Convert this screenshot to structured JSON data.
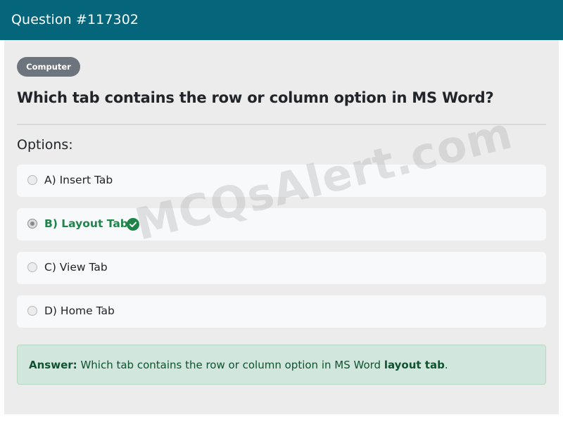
{
  "header": {
    "title": "Question #117302"
  },
  "badge": {
    "label": "Computer"
  },
  "question": {
    "text": "Which tab contains the row or column option in MS Word?"
  },
  "options_heading": "Options:",
  "options": [
    {
      "label": "A) Insert Tab",
      "selected": false,
      "correct": false
    },
    {
      "label": "B) Layout Tab",
      "selected": true,
      "correct": true
    },
    {
      "label": "C) View Tab",
      "selected": false,
      "correct": false
    },
    {
      "label": "D) Home Tab",
      "selected": false,
      "correct": false
    }
  ],
  "answer": {
    "prefix": "Answer:",
    "text": "Which tab contains the row or column option in MS Word",
    "highlight": "layout tab",
    "suffix": "."
  },
  "watermark": "MCQsAlert.com",
  "colors": {
    "header_bg": "#05657a",
    "badge_bg": "#6c757d",
    "correct": "#1e8449",
    "answer_bg": "#d1e7dd"
  }
}
